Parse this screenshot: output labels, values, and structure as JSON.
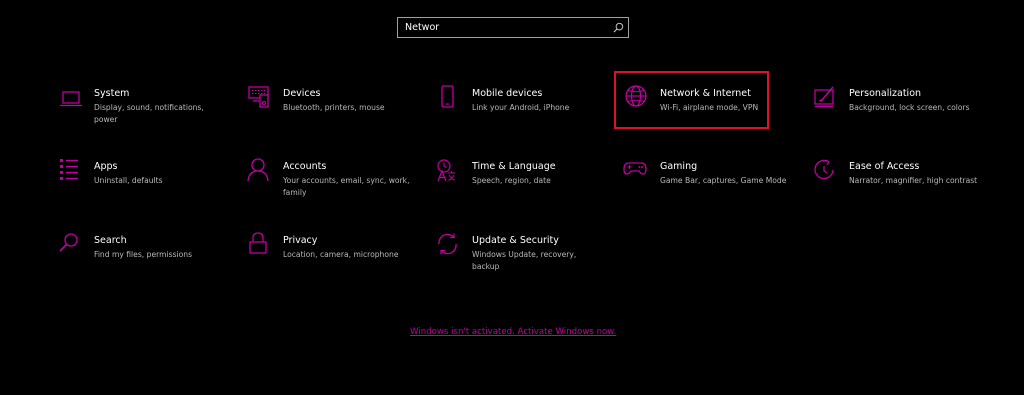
{
  "search": {
    "value": "Networ",
    "placeholder": ""
  },
  "tiles": [
    {
      "title": "System",
      "desc": "Display, sound, notifications, power",
      "icon": "laptop-icon"
    },
    {
      "title": "Devices",
      "desc": "Bluetooth, printers, mouse",
      "icon": "keyboard-devices-icon"
    },
    {
      "title": "Mobile devices",
      "desc": "Link your Android, iPhone",
      "icon": "phone-icon"
    },
    {
      "title": "Network & Internet",
      "desc": "Wi-Fi, airplane mode, VPN",
      "icon": "globe-icon"
    },
    {
      "title": "Personalization",
      "desc": "Background, lock screen, colors",
      "icon": "paint-icon"
    },
    {
      "title": "Apps",
      "desc": "Uninstall, defaults",
      "icon": "apps-list-icon"
    },
    {
      "title": "Accounts",
      "desc": "Your accounts, email, sync, work, family",
      "icon": "person-icon"
    },
    {
      "title": "Time & Language",
      "desc": "Speech, region, date",
      "icon": "time-language-icon"
    },
    {
      "title": "Gaming",
      "desc": "Game Bar, captures, Game Mode",
      "icon": "gamepad-icon"
    },
    {
      "title": "Ease of Access",
      "desc": "Narrator, magnifier, high contrast",
      "icon": "ease-of-access-icon"
    },
    {
      "title": "Search",
      "desc": "Find my files, permissions",
      "icon": "search-icon"
    },
    {
      "title": "Privacy",
      "desc": "Location, camera, microphone",
      "icon": "lock-icon"
    },
    {
      "title": "Update & Security",
      "desc": "Windows Update, recovery, backup",
      "icon": "sync-icon"
    }
  ],
  "activation_link": "Windows isn't activated. Activate Windows now.",
  "colors": {
    "accent": "#c000a0",
    "highlight": "#e0102a",
    "background": "#000000"
  }
}
